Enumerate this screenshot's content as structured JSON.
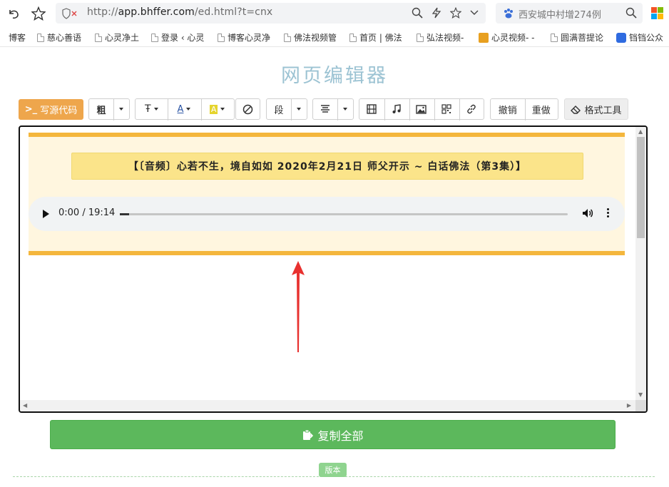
{
  "browser": {
    "url_prefix": "http://",
    "url_domain": "app.bhffer.com",
    "url_path": "/ed.html?t=cnx",
    "search_text": "西安城中村增274例"
  },
  "bookmarks": [
    {
      "label": "博客"
    },
    {
      "label": "慈心善语"
    },
    {
      "label": "心灵净土"
    },
    {
      "label": "登录 ‹ 心灵"
    },
    {
      "label": "博客心灵净"
    },
    {
      "label": "佛法视频管"
    },
    {
      "label": "首页 | 佛法"
    },
    {
      "label": "弘法视频-"
    },
    {
      "label": "心灵视频- -"
    },
    {
      "label": "圆满菩提论"
    },
    {
      "label": "铛铛公众"
    }
  ],
  "page": {
    "title": "网页编辑器"
  },
  "toolbar": {
    "source_code": "写源代码",
    "bold": "粗",
    "paragraph": "段",
    "undo": "撤销",
    "redo": "重做",
    "format_tool": "格式工具"
  },
  "editor": {
    "banner_text": "【〔音频〕心若不生，境自如如 2020年2月21日 师父开示 ~ 白话佛法（第3集）】",
    "audio_time": "0:00 / 19:14",
    "audio_progress": 0.02
  },
  "actions": {
    "copy_all": "复制全部",
    "version": "版本"
  },
  "colors": {
    "source_button": "#eea64c",
    "copy_button": "#5cb85c",
    "border_bar": "#f4b63c",
    "banner_bg": "#fbe48a",
    "title": "#9cc3d3"
  }
}
